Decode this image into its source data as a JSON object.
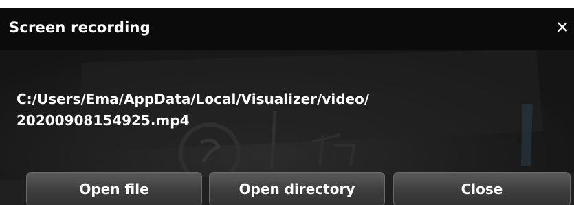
{
  "dialog": {
    "title": "Screen recording",
    "close_glyph": "✕",
    "close_icon": "close-icon",
    "path_line1": "C:/Users/Ema/AppData/Local/Visualizer/video/",
    "path_line2": "20200908154925.mp4"
  },
  "buttons": {
    "open_file": "Open file",
    "open_directory": "Open directory",
    "close": "Close"
  },
  "colors": {
    "titlebar": "#0b0b0b",
    "body": "#1a1a1a",
    "text": "#ffffff",
    "button": "#454545"
  }
}
